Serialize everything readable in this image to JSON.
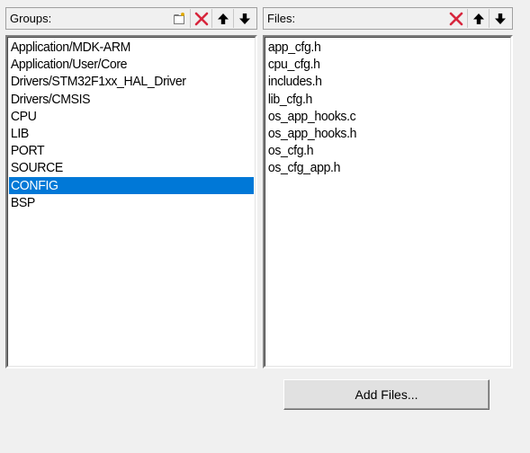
{
  "groups": {
    "header_label": "Groups:",
    "items": [
      {
        "label": "Application/MDK-ARM"
      },
      {
        "label": "Application/User/Core"
      },
      {
        "label": "Drivers/STM32F1xx_HAL_Driver"
      },
      {
        "label": "Drivers/CMSIS"
      },
      {
        "label": "CPU"
      },
      {
        "label": "LIB"
      },
      {
        "label": "PORT"
      },
      {
        "label": "SOURCE"
      },
      {
        "label": "CONFIG",
        "selected": true
      },
      {
        "label": "BSP"
      }
    ]
  },
  "files": {
    "header_label": "Files:",
    "items": [
      {
        "label": "app_cfg.h"
      },
      {
        "label": "cpu_cfg.h"
      },
      {
        "label": "includes.h"
      },
      {
        "label": "lib_cfg.h"
      },
      {
        "label": "os_app_hooks.c"
      },
      {
        "label": "os_app_hooks.h"
      },
      {
        "label": "os_cfg.h"
      },
      {
        "label": "os_cfg_app.h"
      }
    ]
  },
  "add_files_button": {
    "label": "Add Files..."
  },
  "icons": {
    "new": "new-group-icon",
    "delete": "delete-icon",
    "up": "move-up-icon",
    "down": "move-down-icon"
  },
  "colors": {
    "selection": "#0078d7",
    "delete_red": "#d7263d"
  }
}
